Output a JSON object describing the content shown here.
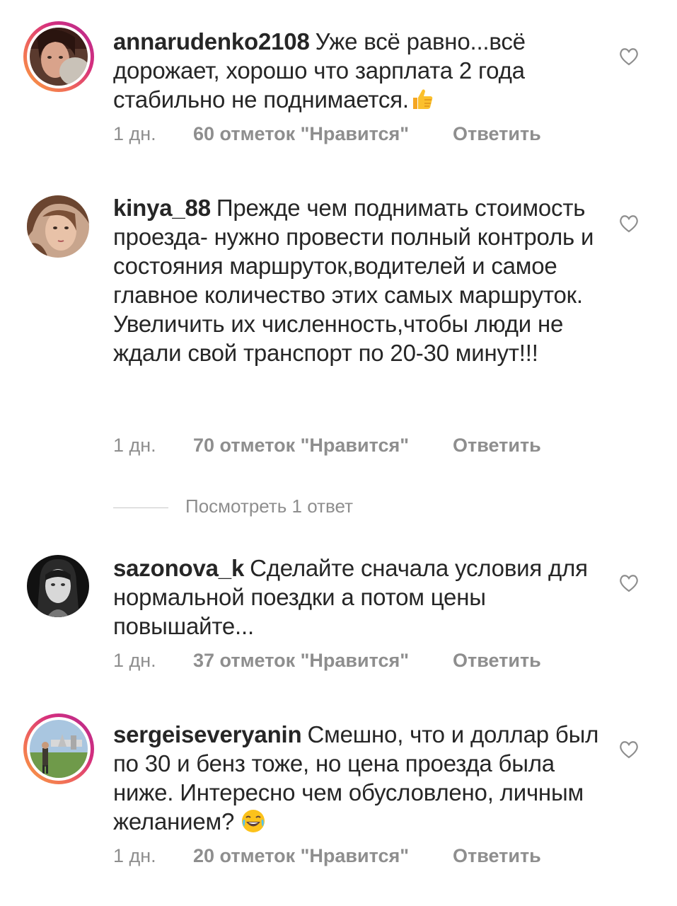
{
  "comments": [
    {
      "username": "annarudenko2108",
      "text": "Уже всё равно...всё дорожает, хорошо что зарплата 2 года стабильно не поднимается.",
      "emoji": "thumbs-up",
      "time": "1 дн.",
      "likes": "60 отметок \"Нравится\"",
      "reply": "Ответить",
      "avatar_icon": "user-avatar"
    },
    {
      "username": "kinya_88",
      "text": "Прежде чем  поднимать стоимость проезда- нужно провести полный контроль и состояния маршруток,водителей и самое главное количество этих самых маршруток. Увеличить их численность,чтобы люди не ждали свой транспорт по 20-30 минут!!!",
      "time": "1 дн.",
      "likes": "70 отметок \"Нравится\"",
      "reply": "Ответить",
      "avatar_icon": "user-avatar"
    },
    {
      "username": "sazonova_k",
      "text": "Сделайте сначала условия для нормальной поездки а потом цены повышайте...",
      "time": "1 дн.",
      "likes": "37 отметок \"Нравится\"",
      "reply": "Ответить",
      "avatar_icon": "user-avatar"
    },
    {
      "username": "sergeiseveryanin",
      "text": "Смешно, что и доллар был по 30 и бенз тоже, но цена проезда была ниже. Интересно чем обусловлено, личным желанием?",
      "emoji": "laughing-face",
      "time": "1 дн.",
      "likes": "20 отметок \"Нравится\"",
      "reply": "Ответить",
      "avatar_icon": "user-avatar"
    }
  ],
  "view_replies": "Посмотреть 1 ответ",
  "colors": {
    "text": "#262626",
    "meta": "#8e8e8e",
    "story_ring_start": "#f9a03f",
    "story_ring_end": "#b42b8f"
  }
}
